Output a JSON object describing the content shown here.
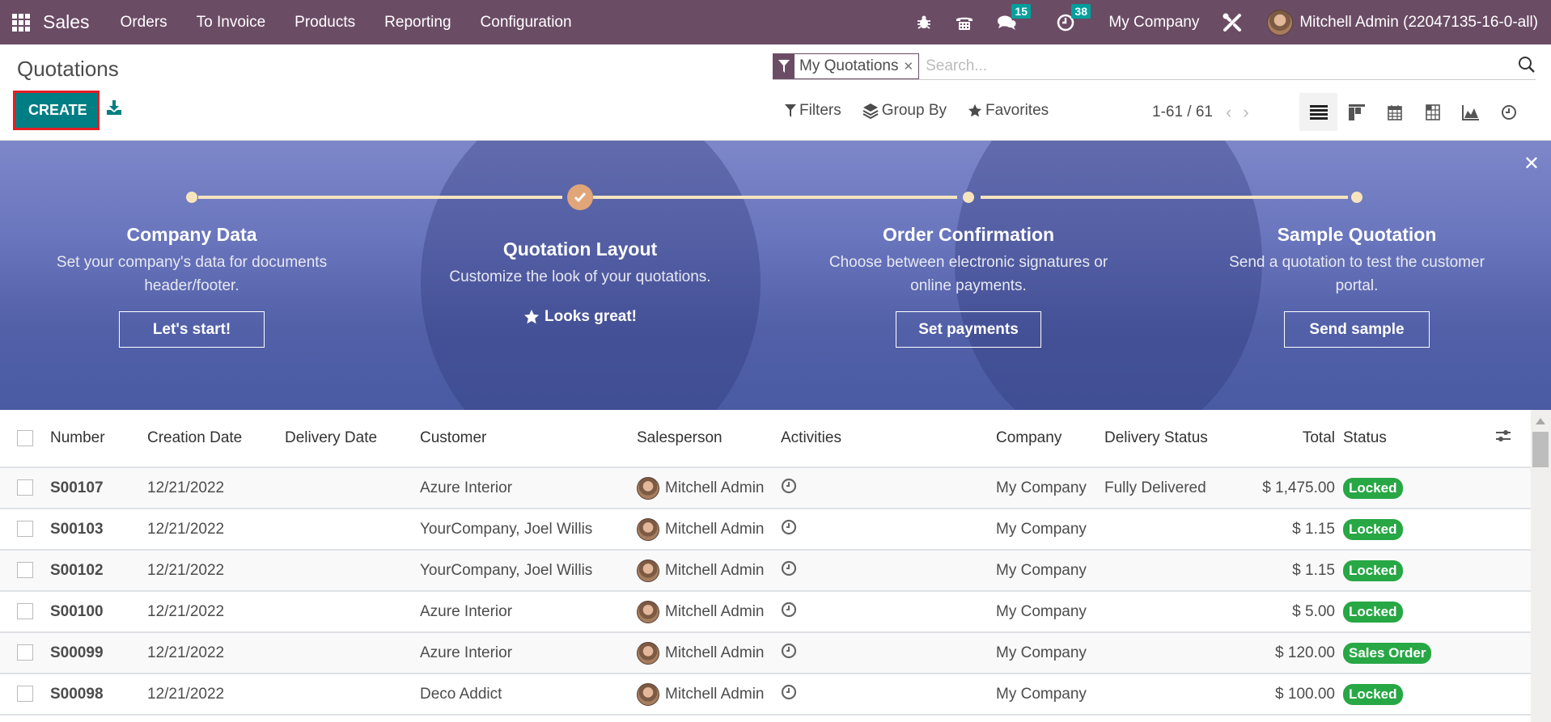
{
  "navbar": {
    "app_name": "Sales",
    "menu": [
      "Orders",
      "To Invoice",
      "Products",
      "Reporting",
      "Configuration"
    ],
    "messages_count": "15",
    "activities_count": "38",
    "company": "My Company",
    "user": "Mitchell Admin (22047135-16-0-all)",
    "icons": [
      "apps-grid-icon",
      "bug-icon",
      "phone-icon",
      "chat-icon",
      "clock-icon",
      "tools-icon"
    ],
    "brand_color": "#6b4c65"
  },
  "control_panel": {
    "title": "Quotations",
    "create_label": "CREATE",
    "create_color": "#017e84",
    "facet_label": "My Quotations",
    "search_placeholder": "Search...",
    "filters_label": "Filters",
    "group_by_label": "Group By",
    "favorites_label": "Favorites",
    "pager": "1-61 / 61",
    "views": [
      "list",
      "kanban",
      "calendar",
      "pivot",
      "graph",
      "activity"
    ],
    "active_view": "list"
  },
  "banner": {
    "steps": [
      {
        "title": "Company Data",
        "desc": "Set your company's data for documents header/footer.",
        "action": "Let's start!",
        "done": false
      },
      {
        "title": "Quotation Layout",
        "desc": "Customize the look of your quotations.",
        "action": "Looks great!",
        "done": true
      },
      {
        "title": "Order Confirmation",
        "desc": "Choose between electronic signatures or online payments.",
        "action": "Set payments",
        "done": false
      },
      {
        "title": "Sample Quotation",
        "desc": "Send a quotation to test the customer portal.",
        "action": "Send sample",
        "done": false
      }
    ]
  },
  "table": {
    "columns": [
      "Number",
      "Creation Date",
      "Delivery Date",
      "Customer",
      "Salesperson",
      "Activities",
      "Company",
      "Delivery Status",
      "Total",
      "Status"
    ],
    "rows": [
      {
        "number": "S00107",
        "creation_date": "12/21/2022",
        "delivery_date": "",
        "customer": "Azure Interior",
        "salesperson": "Mitchell Admin",
        "company": "My Company",
        "delivery_status": "Fully Delivered",
        "total": "$ 1,475.00",
        "status": "Locked"
      },
      {
        "number": "S00103",
        "creation_date": "12/21/2022",
        "delivery_date": "",
        "customer": "YourCompany, Joel Willis",
        "salesperson": "Mitchell Admin",
        "company": "My Company",
        "delivery_status": "",
        "total": "$ 1.15",
        "status": "Locked"
      },
      {
        "number": "S00102",
        "creation_date": "12/21/2022",
        "delivery_date": "",
        "customer": "YourCompany, Joel Willis",
        "salesperson": "Mitchell Admin",
        "company": "My Company",
        "delivery_status": "",
        "total": "$ 1.15",
        "status": "Locked"
      },
      {
        "number": "S00100",
        "creation_date": "12/21/2022",
        "delivery_date": "",
        "customer": "Azure Interior",
        "salesperson": "Mitchell Admin",
        "company": "My Company",
        "delivery_status": "",
        "total": "$ 5.00",
        "status": "Locked"
      },
      {
        "number": "S00099",
        "creation_date": "12/21/2022",
        "delivery_date": "",
        "customer": "Azure Interior",
        "salesperson": "Mitchell Admin",
        "company": "My Company",
        "delivery_status": "",
        "total": "$ 120.00",
        "status": "Sales Order"
      },
      {
        "number": "S00098",
        "creation_date": "12/21/2022",
        "delivery_date": "",
        "customer": "Deco Addict",
        "salesperson": "Mitchell Admin",
        "company": "My Company",
        "delivery_status": "",
        "total": "$ 100.00",
        "status": "Locked"
      }
    ],
    "status_color": "#28a745"
  }
}
